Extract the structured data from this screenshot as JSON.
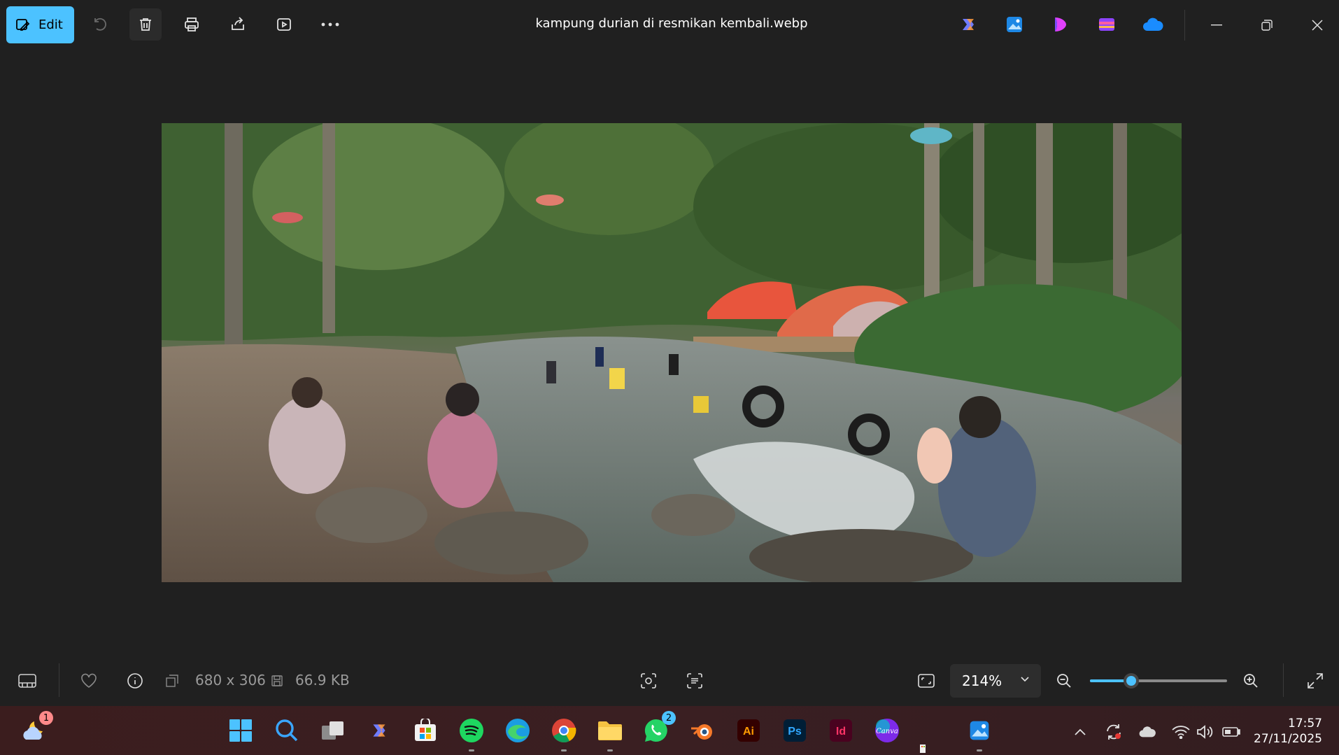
{
  "toolbar": {
    "edit_label": "Edit",
    "title": "kampung durian di resmikan kembali.webp",
    "icons": [
      "rotate-icon",
      "delete-icon",
      "print-icon",
      "share-icon",
      "slideshow-icon",
      "more-icon"
    ],
    "apps": [
      "copilot-icon",
      "photos-icon",
      "clipchamp-icon",
      "designer-icon",
      "onedrive-icon"
    ]
  },
  "photo": {
    "alt": "kampung durian di resmikan kembali"
  },
  "statusbar": {
    "dimensions": "680 x 306",
    "file_size": "66.9 KB",
    "zoom": "214%",
    "zoom_fraction": 0.3
  },
  "taskbar": {
    "weather_badge": "1",
    "whatsapp_badge": "2",
    "time": "17:57",
    "date": "27/11/2025"
  }
}
